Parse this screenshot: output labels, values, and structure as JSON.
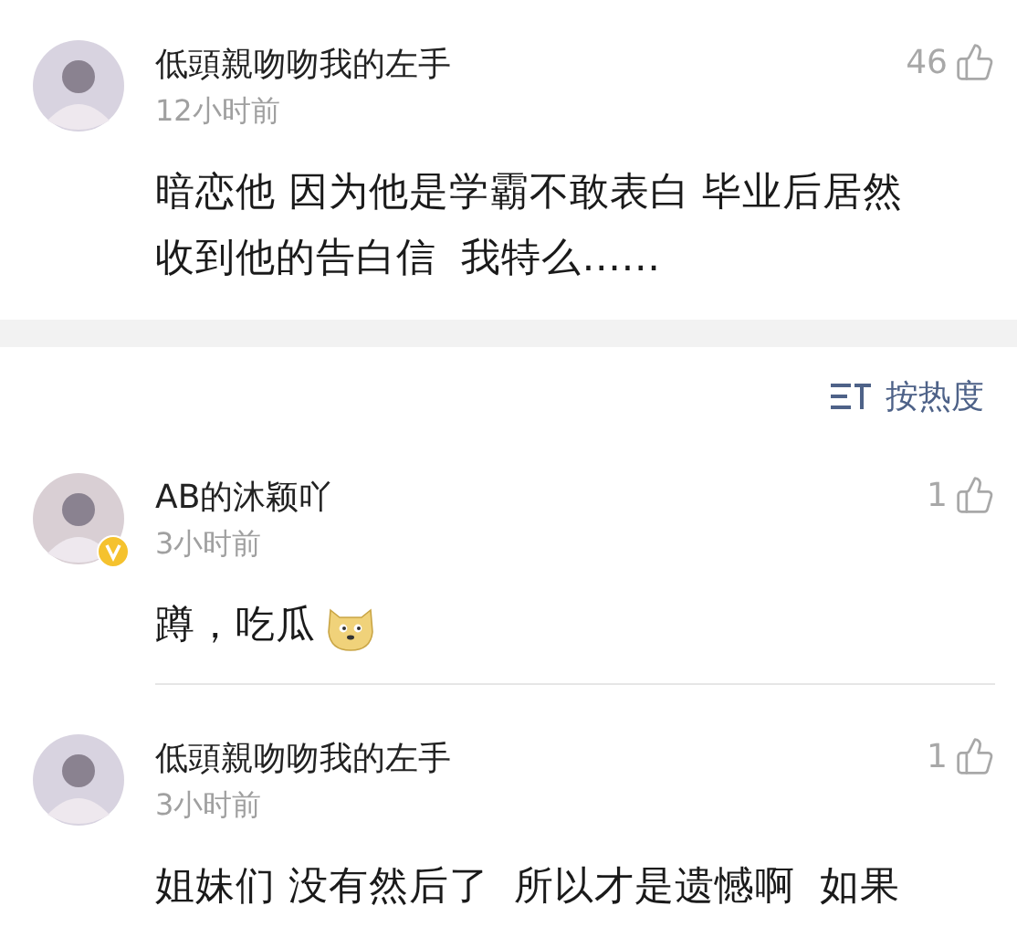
{
  "comments": [
    {
      "name": "低頭親吻吻我的左手",
      "time": "12小时前",
      "likes": "46",
      "verified": false,
      "body": [
        "暗恋他 因为他是学霸不敢表白 毕业后居然",
        "收到他的告白信  我特么……"
      ],
      "emoji": false
    },
    {
      "kind": "sort",
      "label": "按热度"
    },
    {
      "name": "AB的沐颖吖",
      "time": "3小时前",
      "likes": "1",
      "verified": true,
      "body": [
        "蹲，吃瓜"
      ],
      "emoji": true
    },
    {
      "name": "低頭親吻吻我的左手",
      "time": "3小时前",
      "likes": "1",
      "verified": false,
      "body": [
        "姐妹们 没有然后了  所以才是遗憾啊  如果"
      ],
      "emoji": false
    }
  ]
}
